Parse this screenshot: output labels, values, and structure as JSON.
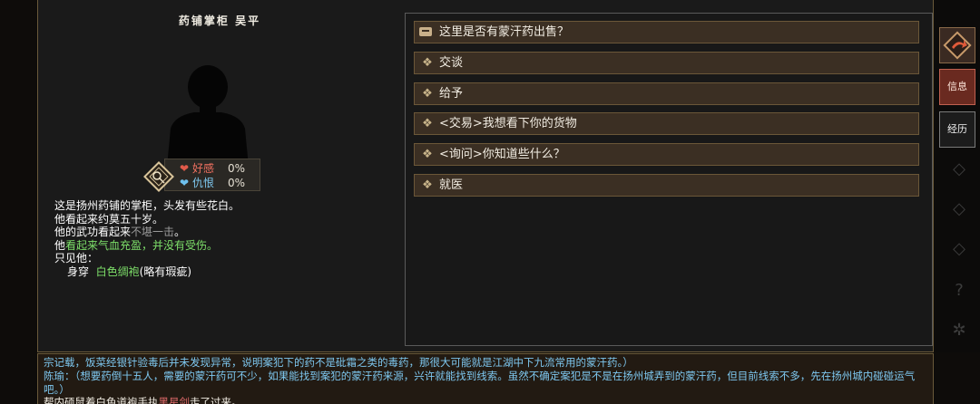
{
  "npc": {
    "title": "药铺掌柜 吴平",
    "relations": {
      "favor_label": "好感",
      "favor_value": "0%",
      "hate_label": "仇恨",
      "hate_value": "0%"
    },
    "description": {
      "line1": "这是扬州药铺的掌柜，头发有些花白。",
      "line2": "他看起来约莫五十岁。",
      "line3_prefix": "他的武功看起来",
      "line3_grey": "不堪一击",
      "line3_suffix": "。",
      "line4_prefix": "他",
      "line4_green": "看起来气血充盈，并没有受伤。",
      "line5": "只见他：",
      "wear_label": "身穿",
      "wear_item": "白色绸袍",
      "wear_note": "(略有瑕疵)"
    }
  },
  "options": [
    {
      "label": "这里是否有蒙汗药出售？",
      "icon": "shop-icon"
    },
    {
      "label": "交谈",
      "icon": "diamond-icon"
    },
    {
      "label": "给予",
      "icon": "diamond-icon"
    },
    {
      "label": "<交易>我想看下你的货物",
      "icon": "diamond-icon"
    },
    {
      "label": "<询问>你知道些什么？",
      "icon": "diamond-icon"
    },
    {
      "label": "就医",
      "icon": "diamond-icon"
    }
  ],
  "side_tabs": {
    "info": "信息",
    "history": "经历"
  },
  "log": {
    "line1": "宗记载，饭菜经银针验毒后并未发现异常，说明案犯下的药不是砒霜之类的毒药，那很大可能就是江湖中下九流常用的蒙汗药。）",
    "line2": "陈瑜：（想要药倒十五人，需要的蒙汗药可不少，如果能找到案犯的蒙汗药来源，兴许就能找到线索。虽然不确定案犯是不是在扬州城弄到的蒙汗药，但目前线索不多，先在扬州城内碰碰运气吧。）",
    "line3_prefix": "帮内硕鼠着白色道袍手执",
    "line3_red": "黑星剑",
    "line3_suffix": "走了过来。"
  },
  "colors": {
    "option_bg": "#3b2f23",
    "option_border": "#6b5738",
    "active_tab": "#6a2a20",
    "log_text": "#7ec8f0",
    "green_text": "#7ee06a",
    "favor_red": "#f07060",
    "hate_blue": "#7ec8f0"
  }
}
